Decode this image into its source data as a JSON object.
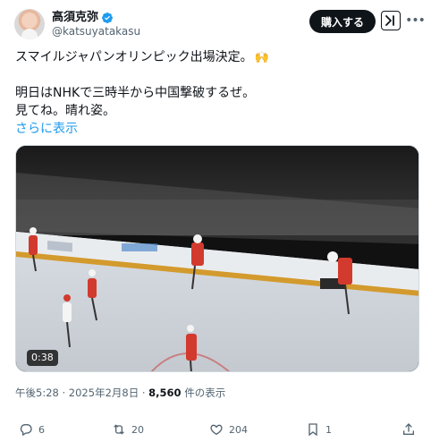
{
  "author": {
    "display_name": "高須克弥",
    "handle": "@katsuyatakasu",
    "verified": true,
    "avatar_icon": "avatar-photo"
  },
  "header_actions": {
    "subscribe_label": "購入する",
    "grok_icon": "grok-icon",
    "more_icon": "more-dots-icon"
  },
  "tweet": {
    "line1": "スマイルジャパンオリンピック出場決定。",
    "line1_emoji": "🙌",
    "line2": "明日はNHKで三時半から中国撃破するぜ。",
    "line3": "見てね。晴れ姿。",
    "show_more": "さらに表示"
  },
  "media": {
    "type": "video",
    "description_icon": "ice-hockey-video-thumbnail",
    "duration": "0:38"
  },
  "meta": {
    "time": "午後5:28",
    "separator": "·",
    "date": "2025年2月8日",
    "views_count": "8,560",
    "views_label": "件の表示"
  },
  "actions": {
    "reply_count": "6",
    "retweet_count": "20",
    "like_count": "204",
    "bookmark_count": "1"
  },
  "colors": {
    "accent": "#1d9bf0",
    "text": "#0f1419",
    "muted": "#536471"
  }
}
